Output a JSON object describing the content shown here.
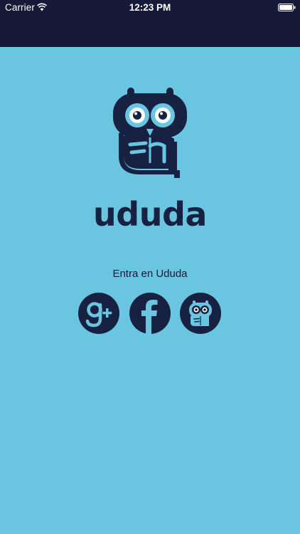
{
  "status_bar": {
    "carrier": "Carrier",
    "time": "12:23 PM",
    "icons": [
      "wifi-icon",
      "battery-icon"
    ]
  },
  "brand": {
    "name": "ududa",
    "logo_icon": "owl-logo-icon"
  },
  "login": {
    "prompt": "Entra en Ududa",
    "buttons": [
      {
        "id": "google",
        "icon": "google-plus-icon"
      },
      {
        "id": "facebook",
        "icon": "facebook-icon"
      },
      {
        "id": "ududa",
        "icon": "owl-icon"
      }
    ]
  },
  "colors": {
    "background": "#6ac5e1",
    "topbar": "#161a38",
    "dark_navy": "#172141"
  }
}
